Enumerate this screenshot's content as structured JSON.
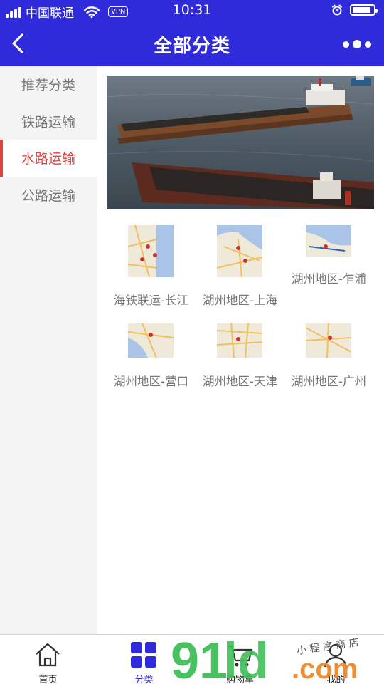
{
  "status_bar": {
    "carrier": "中国联通",
    "vpn": "VPN",
    "time": "10:31",
    "battery_level": 0.9
  },
  "navbar": {
    "title": "全部分类",
    "back_icon": "chevron-left-icon",
    "more_icon": "more-dots-icon"
  },
  "sidebar": {
    "items": [
      {
        "label": "推荐分类"
      },
      {
        "label": "铁路运输"
      },
      {
        "label": "水路运输"
      },
      {
        "label": "公路运输"
      }
    ],
    "active_index": 2
  },
  "banner": {
    "subject": "cargo barges on river"
  },
  "grid": {
    "items": [
      {
        "label": "海铁联运-长江"
      },
      {
        "label": "湖州地区-上海"
      },
      {
        "label": "湖州地区-乍浦"
      },
      {
        "label": "湖州地区-营口"
      },
      {
        "label": "湖州地区-天津"
      },
      {
        "label": "湖州地区-广州"
      }
    ]
  },
  "tabbar": {
    "items": [
      {
        "label": "首页",
        "icon": "home-icon"
      },
      {
        "label": "分类",
        "icon": "grid-icon"
      },
      {
        "label": "购物车",
        "icon": "cart-icon"
      },
      {
        "label": "我的",
        "icon": "user-icon"
      }
    ],
    "active_index": 1
  },
  "watermark": {
    "main": "91",
    "ld": "ld",
    "dot_com": ".com",
    "tagline": "小 程 序 商 店"
  },
  "colors": {
    "primary": "#2f2bdb",
    "active_red": "#e0443f",
    "watermark_green": "#3fbf58",
    "watermark_orange": "#f0882a"
  }
}
